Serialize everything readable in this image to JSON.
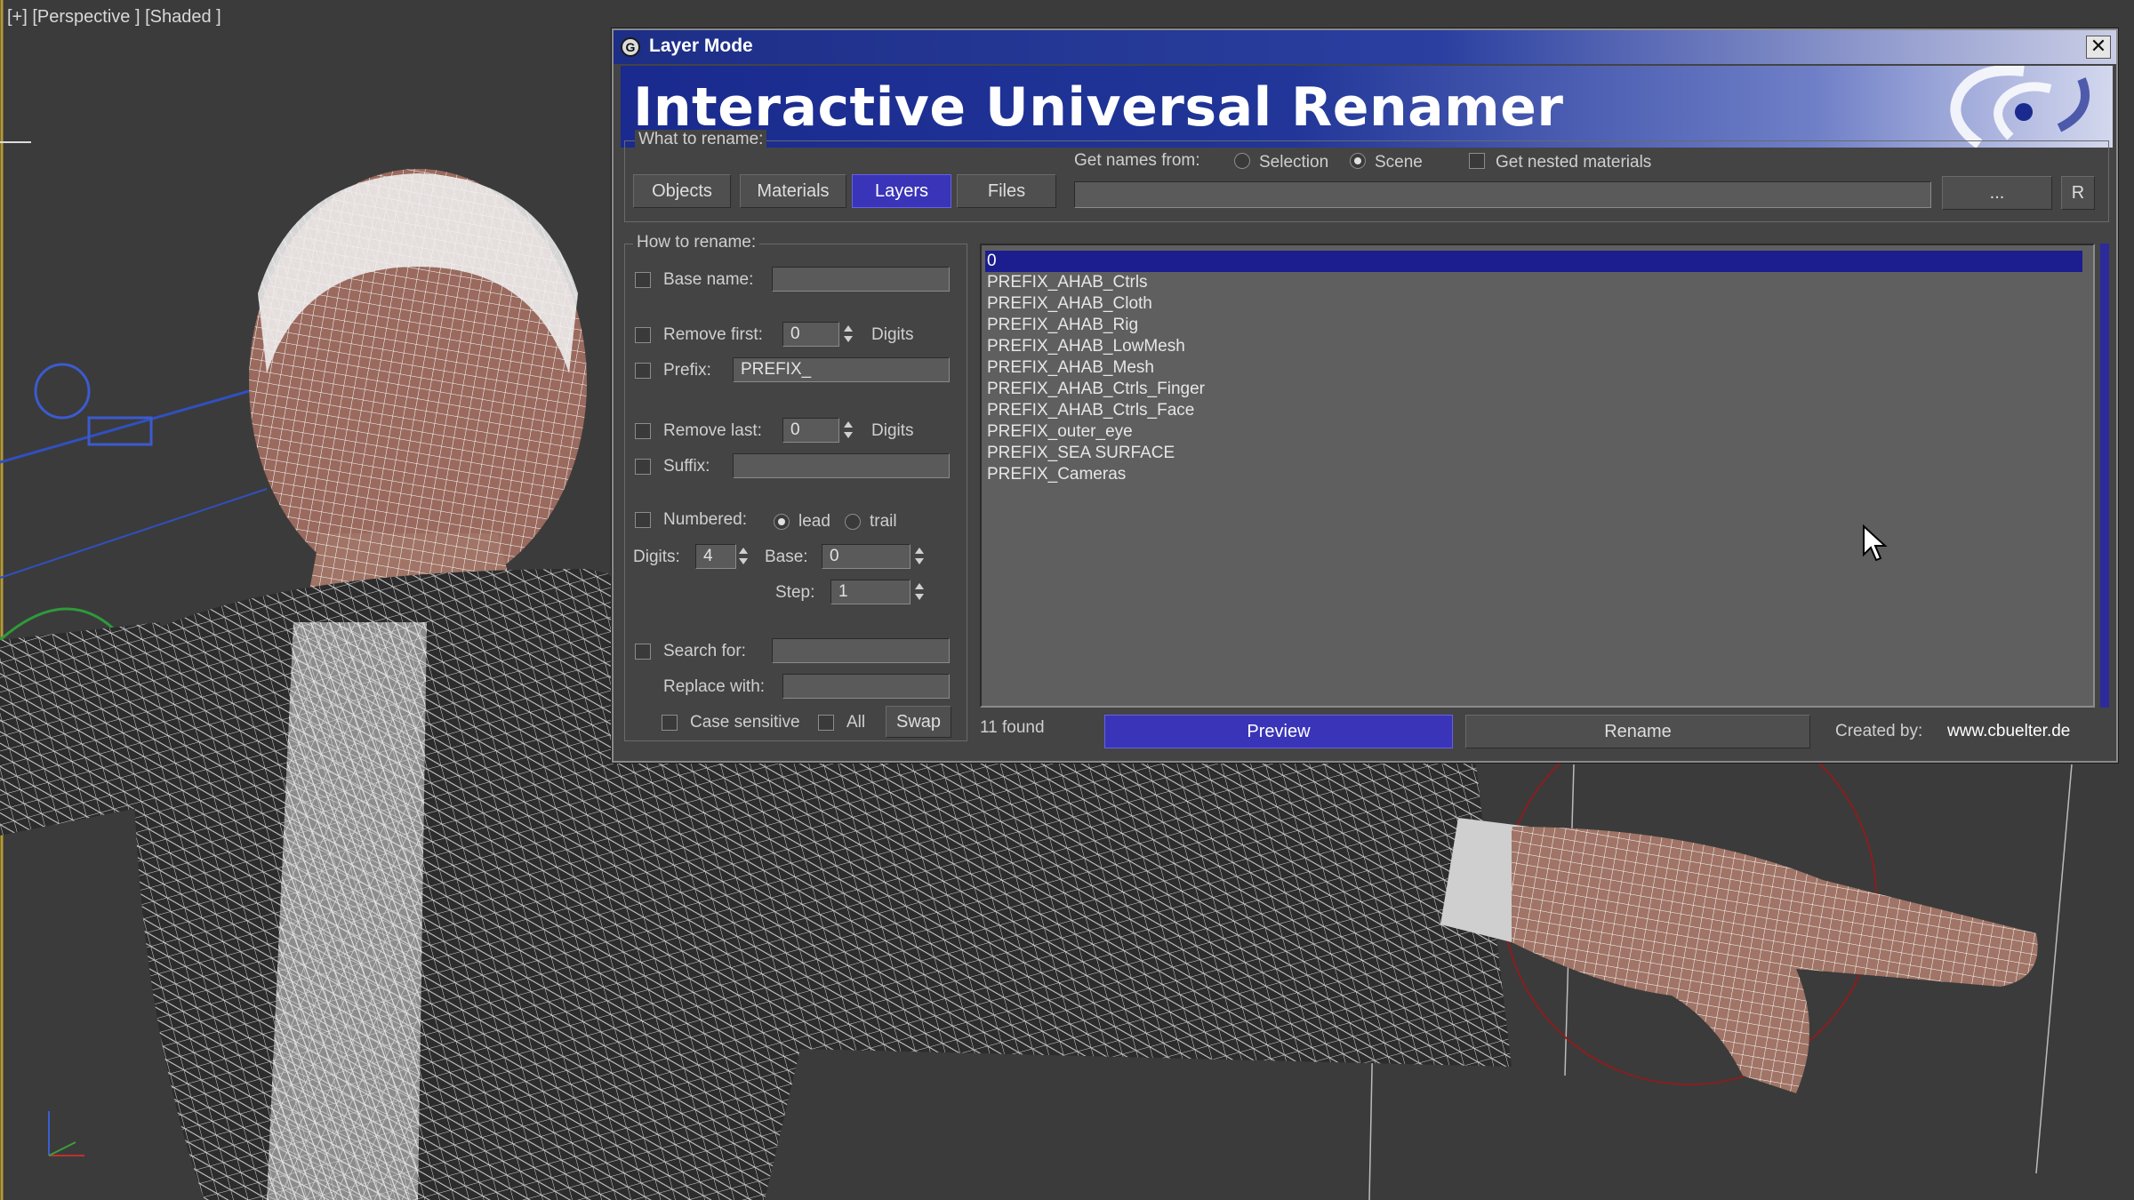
{
  "viewport": {
    "label": "[+] [Perspective ] [Shaded ]"
  },
  "dialog": {
    "title": "Layer Mode",
    "close_label": "✕",
    "banner_title": "Interactive Universal Renamer",
    "what_to_rename": {
      "label": "What to rename:",
      "tabs": [
        {
          "label": "Objects",
          "active": false
        },
        {
          "label": "Materials",
          "active": false
        },
        {
          "label": "Layers",
          "active": true
        },
        {
          "label": "Files",
          "active": false
        }
      ],
      "get_names_from_label": "Get names from:",
      "selection_label": "Selection",
      "scene_label": "Scene",
      "source_selected": "Scene",
      "nested_label": "Get nested materials",
      "path_value": "",
      "browse_label": "...",
      "r_label": "R"
    },
    "how_to_rename": {
      "label": "How to rename:",
      "base_name_label": "Base name:",
      "base_name_value": "",
      "remove_first_label": "Remove first:",
      "remove_first_value": "0",
      "digits_unit": "Digits",
      "prefix_label": "Prefix:",
      "prefix_value": "PREFIX_",
      "remove_last_label": "Remove last:",
      "remove_last_value": "0",
      "suffix_label": "Suffix:",
      "suffix_value": "",
      "numbered_label": "Numbered:",
      "lead_label": "lead",
      "trail_label": "trail",
      "numbering_position": "lead",
      "digits_label": "Digits:",
      "digits_value": "4",
      "base_label": "Base:",
      "base_value": "0",
      "step_label": "Step:",
      "step_value": "1",
      "search_label": "Search for:",
      "search_value": "",
      "replace_label": "Replace with:",
      "replace_value": "",
      "case_sensitive_label": "Case sensitive",
      "all_label": "All",
      "swap_label": "Swap"
    },
    "list": {
      "items": [
        "0",
        "PREFIX_AHAB_Ctrls",
        "PREFIX_AHAB_Cloth",
        "PREFIX_AHAB_Rig",
        "PREFIX_AHAB_LowMesh",
        "PREFIX_AHAB_Mesh",
        "PREFIX_AHAB_Ctrls_Finger",
        "PREFIX_AHAB_Ctrls_Face",
        "PREFIX_outer_eye",
        "PREFIX_SEA SURFACE",
        "PREFIX_Cameras"
      ],
      "selected_index": 0
    },
    "footer": {
      "found_text": "11 found",
      "preview_label": "Preview",
      "rename_label": "Rename",
      "created_by_label": "Created by:",
      "created_by_value": "www.cbuelter.de"
    }
  }
}
